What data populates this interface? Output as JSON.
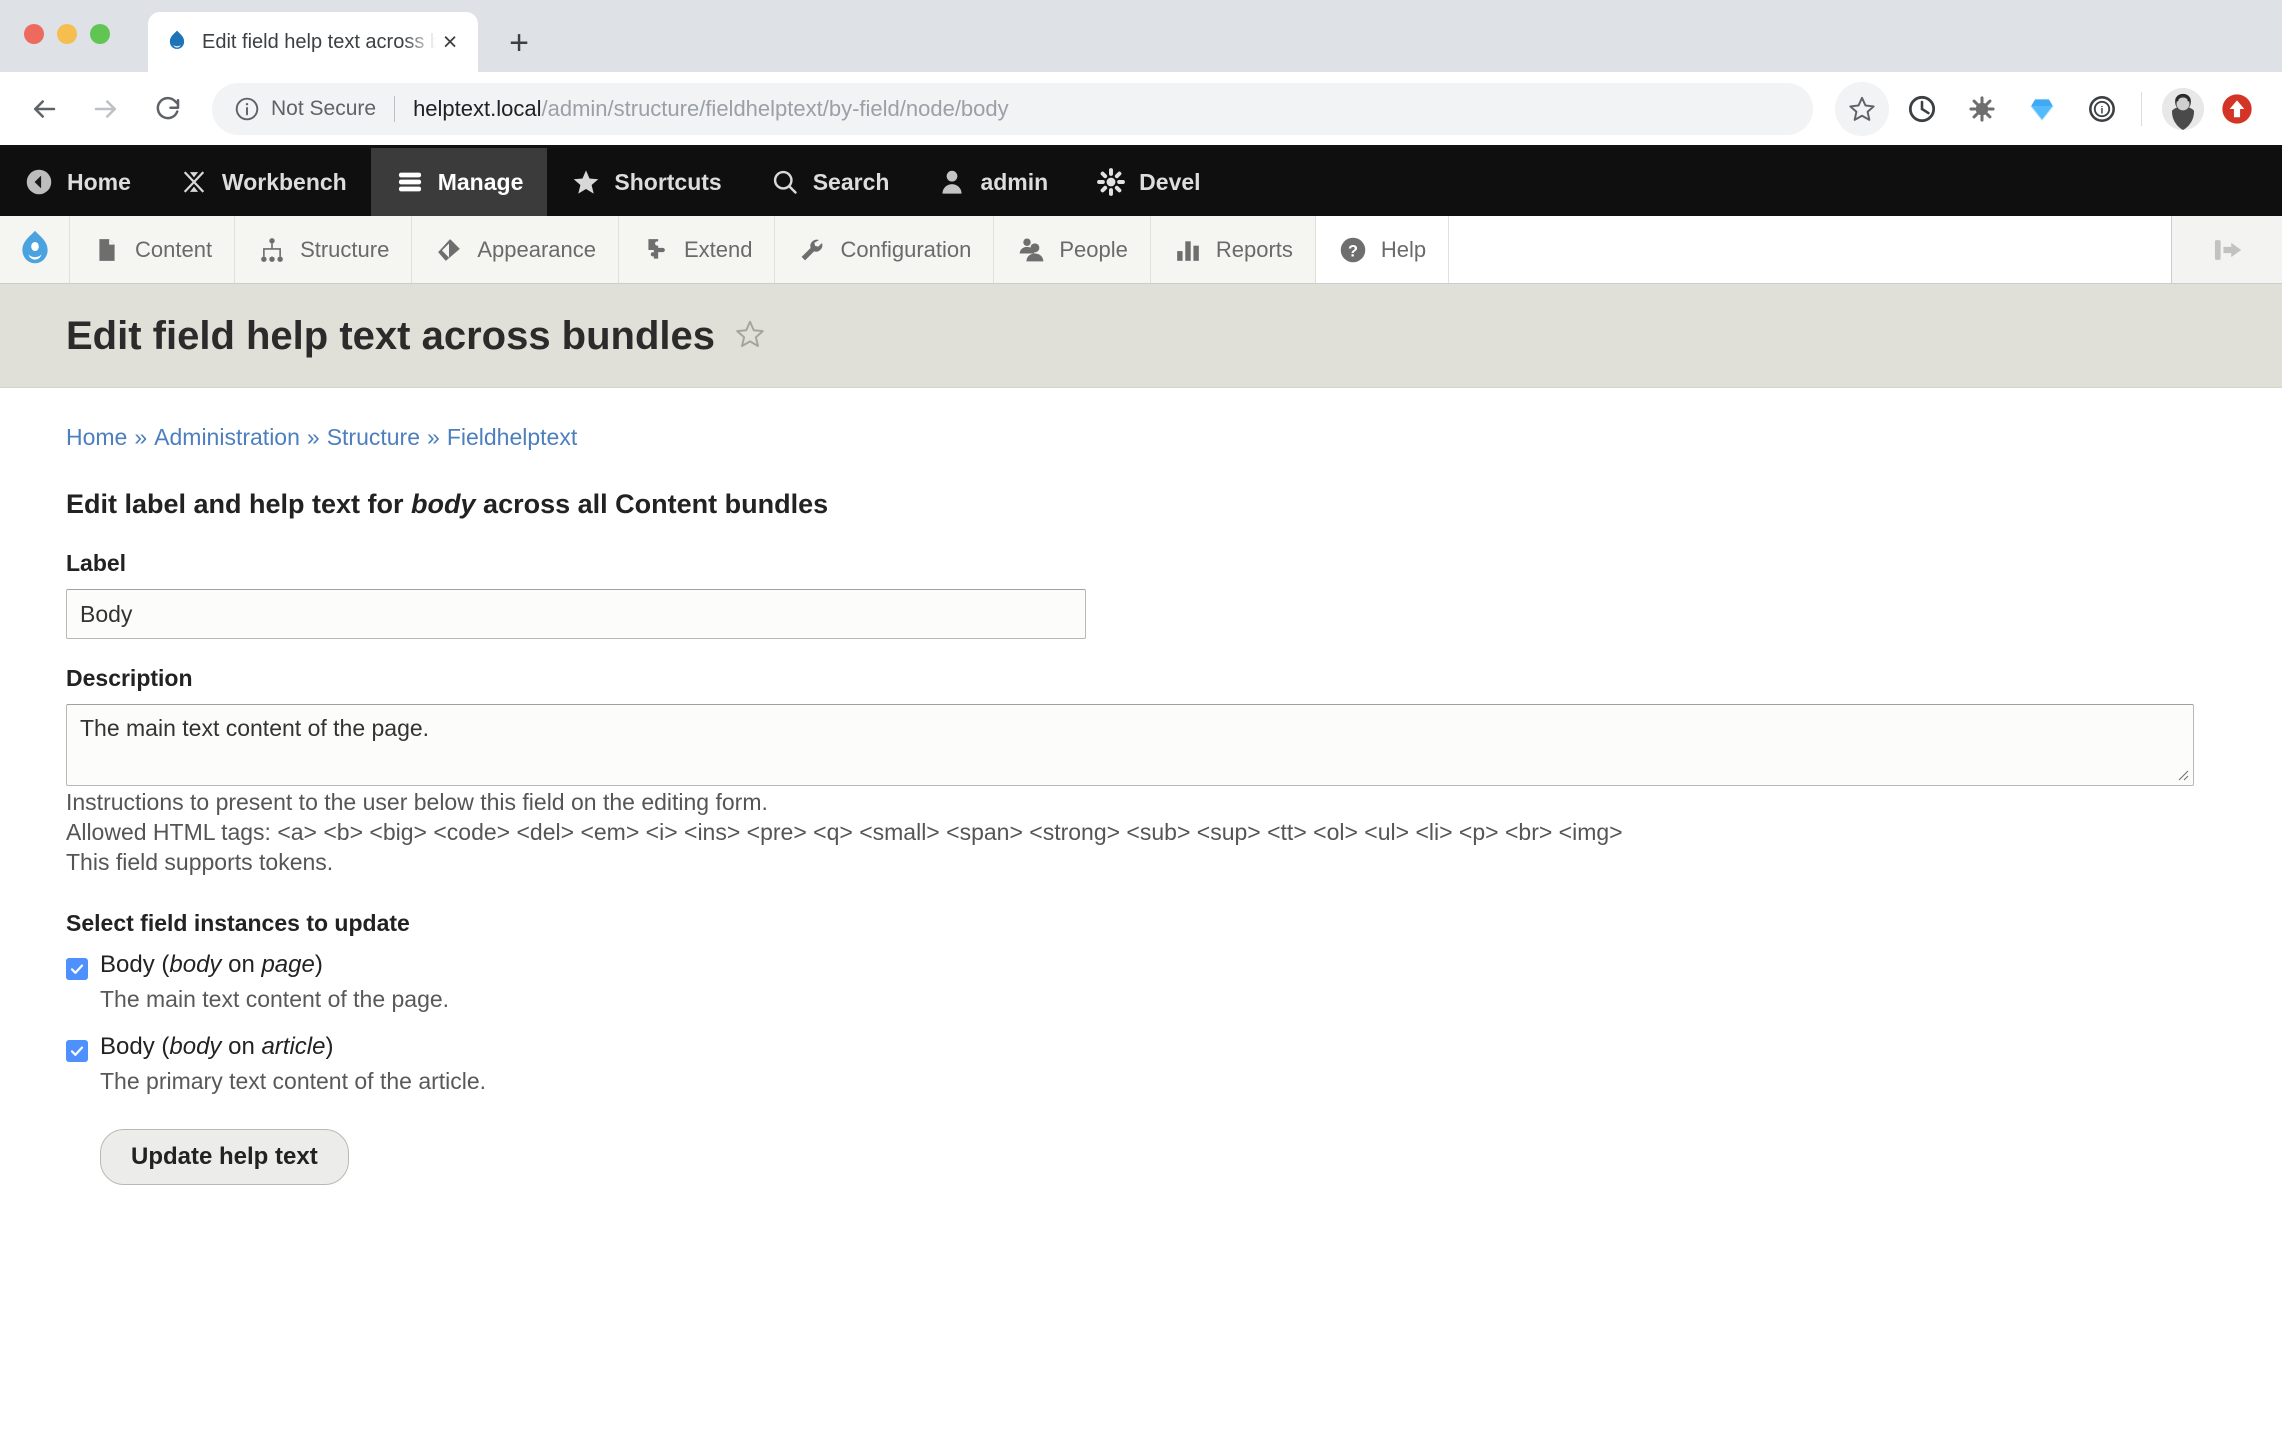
{
  "browser": {
    "tab": {
      "title": "Edit field help text across bund",
      "favicon": "drupal-droplet-icon",
      "close_label": "×",
      "new_tab_label": "+"
    },
    "nav": {
      "back": "back-icon",
      "forward": "forward-icon",
      "reload": "reload-icon"
    },
    "address": {
      "security_label": "Not Secure",
      "security_icon": "info-circle-icon",
      "host": "helptext.local",
      "path": "/admin/structure/fieldhelptext/by-field/node/body",
      "full_url": "helptext.local/admin/structure/fieldhelptext/by-field/node/body"
    },
    "extensions": [
      {
        "name": "bookmark-star-icon"
      },
      {
        "name": "clock-circle-icon"
      },
      {
        "name": "gear-bug-icon"
      },
      {
        "name": "diamond-icon"
      },
      {
        "name": "info-badge-icon"
      },
      {
        "name": "profile-avatar"
      },
      {
        "name": "upload-arrow-icon"
      }
    ]
  },
  "admin_toolbar": {
    "items": [
      {
        "label": "Home",
        "icon": "back-circle-icon",
        "active": false
      },
      {
        "label": "Workbench",
        "icon": "workbench-icon",
        "active": false
      },
      {
        "label": "Manage",
        "icon": "hamburger-icon",
        "active": true
      },
      {
        "label": "Shortcuts",
        "icon": "star-icon",
        "active": false
      },
      {
        "label": "Search",
        "icon": "search-icon",
        "active": false
      },
      {
        "label": "admin",
        "icon": "person-icon",
        "active": false
      },
      {
        "label": "Devel",
        "icon": "gear-icon",
        "active": false
      }
    ]
  },
  "manage_menu": {
    "logo": "drupal-logo",
    "items": [
      {
        "label": "Content",
        "icon": "document-icon"
      },
      {
        "label": "Structure",
        "icon": "hierarchy-icon"
      },
      {
        "label": "Appearance",
        "icon": "paintbrush-icon"
      },
      {
        "label": "Extend",
        "icon": "puzzle-icon"
      },
      {
        "label": "Configuration",
        "icon": "wrench-icon"
      },
      {
        "label": "People",
        "icon": "people-icon"
      },
      {
        "label": "Reports",
        "icon": "bar-chart-icon"
      },
      {
        "label": "Help",
        "icon": "question-circle-icon"
      }
    ],
    "collapse_icon": "collapse-left-icon"
  },
  "page": {
    "title": "Edit field help text across bundles",
    "star_icon": "favorite-star-icon",
    "breadcrumb": [
      {
        "label": "Home"
      },
      {
        "label": "Administration"
      },
      {
        "label": "Structure"
      },
      {
        "label": "Fieldhelptext"
      }
    ],
    "breadcrumb_separator": "»",
    "heading_prefix": "Edit label and help text for ",
    "heading_field": "body",
    "heading_suffix": " across all Content bundles"
  },
  "form": {
    "label_field": {
      "label": "Label",
      "value": "Body"
    },
    "description_field": {
      "label": "Description",
      "value": "The main text content of the page."
    },
    "help_lines": [
      "Instructions to present to the user below this field on the editing form.",
      "Allowed HTML tags: <a> <b> <big> <code> <del> <em> <i> <ins> <pre> <q> <small> <span> <strong> <sub> <sup> <tt> <ol> <ul> <li> <p> <br> <img>",
      "This field supports tokens."
    ],
    "instances_title": "Select field instances to update",
    "instances": [
      {
        "checked": true,
        "label_prefix": "Body (",
        "field_name": "body",
        "label_middle": " on ",
        "bundle": "page",
        "label_suffix": ")",
        "description": "The main text content of the page."
      },
      {
        "checked": true,
        "label_prefix": "Body (",
        "field_name": "body",
        "label_middle": " on ",
        "bundle": "article",
        "label_suffix": ")",
        "description": "The primary text content of the article."
      }
    ],
    "submit_label": "Update help text"
  },
  "colors": {
    "toolbar_black": "#0f0f0f",
    "toolbar_active": "#3b3b3b",
    "page_head_bg": "#e0e0d8",
    "link_blue": "#4d7fbe",
    "checkbox_blue": "#4d90fe",
    "drupal_blue": "#2e8bc9"
  }
}
